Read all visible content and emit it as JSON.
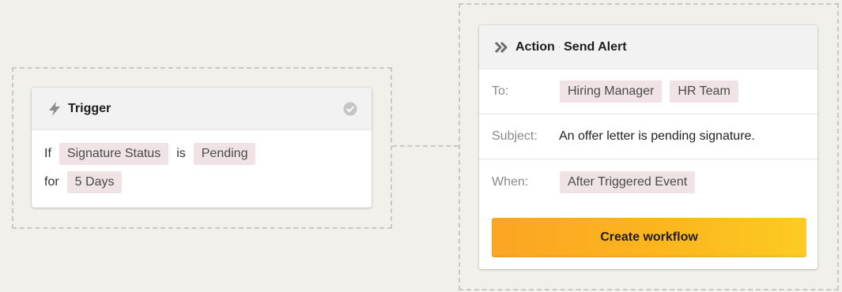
{
  "trigger": {
    "title": "Trigger",
    "row1": {
      "prefix": "If",
      "field": "Signature Status",
      "operator": "is",
      "value": "Pending"
    },
    "row2": {
      "prefix": "for",
      "duration": "5 Days"
    },
    "icons": {
      "header": "lightning-icon",
      "status": "check-circle-icon"
    }
  },
  "action": {
    "title": "Action",
    "separator": "·",
    "subtitle": "Send Alert",
    "icon": "double-chevron-right-icon",
    "to": {
      "label": "To:",
      "recipients": [
        "Hiring Manager",
        "HR Team"
      ]
    },
    "subject": {
      "label": "Subject:",
      "value": "An offer letter is pending signature."
    },
    "when": {
      "label": "When:",
      "value": "After Triggered Event"
    },
    "cta_label": "Create workflow"
  },
  "colors": {
    "background": "#f1f0ea",
    "chip": "#efe3e6",
    "cta_start": "#fba524",
    "cta_end": "#fdcb22",
    "dashed_border": "#c9c8c1"
  }
}
